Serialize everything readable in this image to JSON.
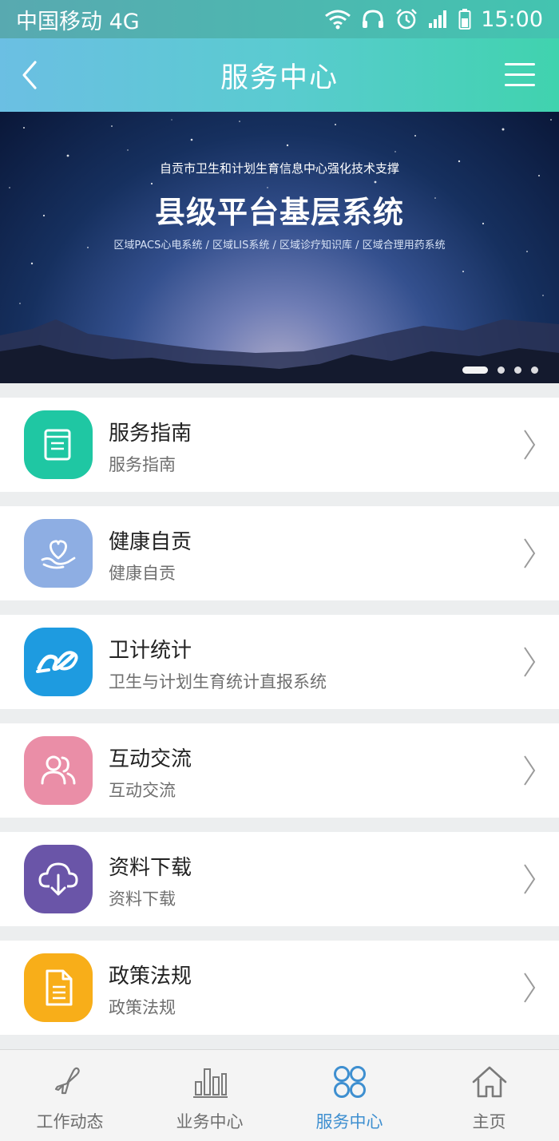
{
  "status_bar": {
    "carrier": "中国移动 4G",
    "time": "15:00",
    "icons": [
      "wifi-icon",
      "headphones-icon",
      "alarm-icon",
      "signal-icon",
      "battery-icon"
    ]
  },
  "nav": {
    "title": "服务中心",
    "back_icon": "back-chevron-icon",
    "menu_icon": "hamburger-menu-icon"
  },
  "banner": {
    "subtitle": "自贡市卫生和计划生育信息中心强化技术支撑",
    "title": "县级平台基层系统",
    "tags": "区域PACS心电系统  /  区域LIS系统  /  区域诊疗知识库  /  区域合理用药系统",
    "pagination": {
      "total": 4,
      "active_index": 0
    }
  },
  "services": [
    {
      "title": "服务指南",
      "subtitle": "服务指南",
      "icon": "document-icon",
      "color": "#1fc7a3"
    },
    {
      "title": "健康自贡",
      "subtitle": "健康自贡",
      "icon": "heart-in-hand-icon",
      "color": "#8eaee3"
    },
    {
      "title": "卫计统计",
      "subtitle": "卫生与计划生育统计直报系统",
      "icon": "statistics-logo-icon",
      "color": "#1e9be0"
    },
    {
      "title": "互动交流",
      "subtitle": "互动交流",
      "icon": "people-icon",
      "color": "#ea8ea7"
    },
    {
      "title": "资料下载",
      "subtitle": "资料下载",
      "icon": "cloud-download-icon",
      "color": "#6a55a8"
    },
    {
      "title": "政策法规",
      "subtitle": "政策法规",
      "icon": "file-text-icon",
      "color": "#f8ae19"
    }
  ],
  "tabbar": {
    "tabs": [
      {
        "label": "工作动态",
        "icon": "airplane-icon",
        "active": false
      },
      {
        "label": "业务中心",
        "icon": "bar-chart-icon",
        "active": false
      },
      {
        "label": "服务中心",
        "icon": "grid-icon",
        "active": true
      },
      {
        "label": "主页",
        "icon": "home-icon",
        "active": false
      }
    ],
    "active_color": "#3e8fd0"
  }
}
